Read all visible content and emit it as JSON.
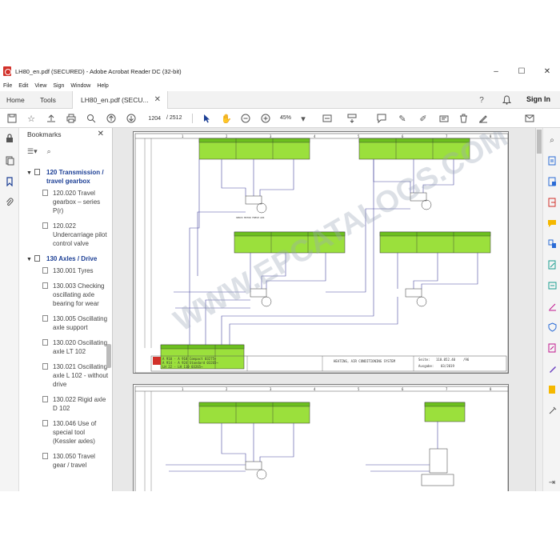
{
  "window": {
    "title": "LH80_en.pdf (SECURED) - Adobe Acrobat Reader DC (32-bit)",
    "controls": [
      "–",
      "☐",
      "✕"
    ]
  },
  "menu": [
    "File",
    "Edit",
    "View",
    "Sign",
    "Window",
    "Help"
  ],
  "tabs": {
    "home": "Home",
    "tools": "Tools",
    "document": "LH80_en.pdf (SECU...",
    "signin": "Sign In"
  },
  "toolbar": {
    "page_current": "1204",
    "page_total": "/ 2512",
    "zoom": "45%"
  },
  "bookmarks": {
    "header": "Bookmarks",
    "items": [
      {
        "level": 1,
        "label": "120 Transmission / travel gearbox"
      },
      {
        "level": 2,
        "label": "120.020 Travel gearbox – series P(r)"
      },
      {
        "level": 2,
        "label": "120.022 Undercarriage pilot control valve"
      },
      {
        "level": 1,
        "label": "130 Axles / Drive"
      },
      {
        "level": 2,
        "label": "130.001 Tyres"
      },
      {
        "level": 2,
        "label": "130.003 Checking oscillating axle bearing for wear"
      },
      {
        "level": 2,
        "label": "130.005 Oscillating axle support"
      },
      {
        "level": 2,
        "label": "130.020 Oscillating axle LT 102"
      },
      {
        "level": 2,
        "label": "130.021 Oscillating axle L 102 - without drive"
      },
      {
        "level": 2,
        "label": "130.022 Rigid axle D 102"
      },
      {
        "level": 2,
        "label": "130.046 Use of special tool (Kessler axles)"
      },
      {
        "level": 2,
        "label": "130.050 Travel gear / travel"
      }
    ]
  },
  "schematic": {
    "title_block": {
      "system": "HEATING, AIR CONDITIONING SYSTEM",
      "seite_label": "Seite:",
      "seite_value": "110.052.40",
      "seite_num": "/96",
      "ausgabe_label": "Ausgabe:",
      "ausgabe_value": "03/2019",
      "models": [
        "A 910 - A 918 Compact 03275→",
        "A 914 - A 924 Standard 03265→",
        "LH 22 - LH 110 03265→"
      ]
    },
    "column_numbers": [
      "1",
      "2",
      "3",
      "4",
      "5",
      "6",
      "7",
      "8"
    ],
    "servo_label": "SERVO MOTOR FRESH AIR",
    "watermark": "WWW.EPCATALOGS.COM"
  },
  "colors": {
    "accent_blue": "#1c3f95",
    "module_green": "#9be03c",
    "module_dark": "#6cbf1e",
    "acrobat_red": "#d2312a",
    "watermark": "#9aa6b6"
  }
}
